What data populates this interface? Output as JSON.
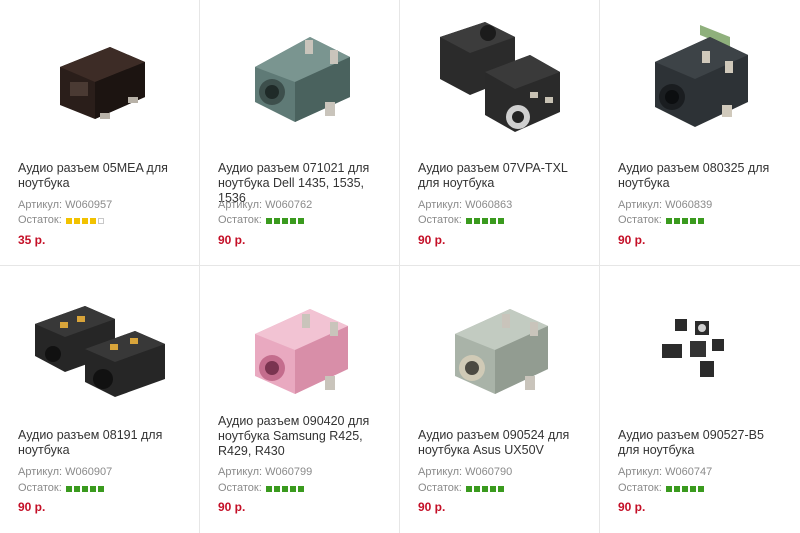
{
  "products": [
    {
      "title": "Аудио разъем 05MEA для ноутбука",
      "article_label": "Артикул:",
      "article": "W060957",
      "stock_label": "Остаток:",
      "stock_level": 4,
      "stock_max": 5,
      "stock_color": "#f2c200",
      "price": "35 р.",
      "image_icon": "audio-jack-black-icon"
    },
    {
      "title": "Аудио разъем 071021 для ноутбука Dell 1435, 1535, 1536",
      "article_label": "Артикул:",
      "article": "W060762",
      "stock_label": "Остаток:",
      "stock_level": 5,
      "stock_max": 5,
      "stock_color": "#3a9a1e",
      "price": "90 р.",
      "image_icon": "audio-jack-teal-icon"
    },
    {
      "title": "Аудио разъем 07VPA-TXL для ноутбука",
      "article_label": "Артикул:",
      "article": "W060863",
      "stock_label": "Остаток:",
      "stock_level": 5,
      "stock_max": 5,
      "stock_color": "#3a9a1e",
      "price": "90 р.",
      "image_icon": "audio-jack-pair-icon"
    },
    {
      "title": "Аудио разъем 080325 для ноутбука",
      "article_label": "Артикул:",
      "article": "W060839",
      "stock_label": "Остаток:",
      "stock_level": 5,
      "stock_max": 5,
      "stock_color": "#3a9a1e",
      "price": "90 р.",
      "image_icon": "audio-jack-dark-icon"
    },
    {
      "title": "Аудио разъем 08191 для ноутбука",
      "article_label": "Артикул:",
      "article": "W060907",
      "stock_label": "Остаток:",
      "stock_level": 5,
      "stock_max": 5,
      "stock_color": "#3a9a1e",
      "price": "90 р.",
      "image_icon": "audio-jack-pair-gold-icon"
    },
    {
      "title": "Аудио разъем 090420 для ноутбука Samsung R425, R429, R430",
      "article_label": "Артикул:",
      "article": "W060799",
      "stock_label": "Остаток:",
      "stock_level": 5,
      "stock_max": 5,
      "stock_color": "#3a9a1e",
      "price": "90 р.",
      "image_icon": "audio-jack-pink-icon"
    },
    {
      "title": "Аудио разъем 090524 для ноутбука Asus UX50V",
      "article_label": "Артикул:",
      "article": "W060790",
      "stock_label": "Остаток:",
      "stock_level": 5,
      "stock_max": 5,
      "stock_color": "#3a9a1e",
      "price": "90 р.",
      "image_icon": "audio-jack-grey-icon"
    },
    {
      "title": "Аудио разъем 090527-B5 для ноутбука",
      "article_label": "Артикул:",
      "article": "W060747",
      "stock_label": "Остаток:",
      "stock_level": 5,
      "stock_max": 5,
      "stock_color": "#3a9a1e",
      "price": "90 р.",
      "image_icon": "audio-jack-small-set-icon"
    }
  ],
  "colors": {
    "empty_bar": "#ffffff",
    "empty_bar_border": "#c8c8c8",
    "price": "#c40f27"
  }
}
